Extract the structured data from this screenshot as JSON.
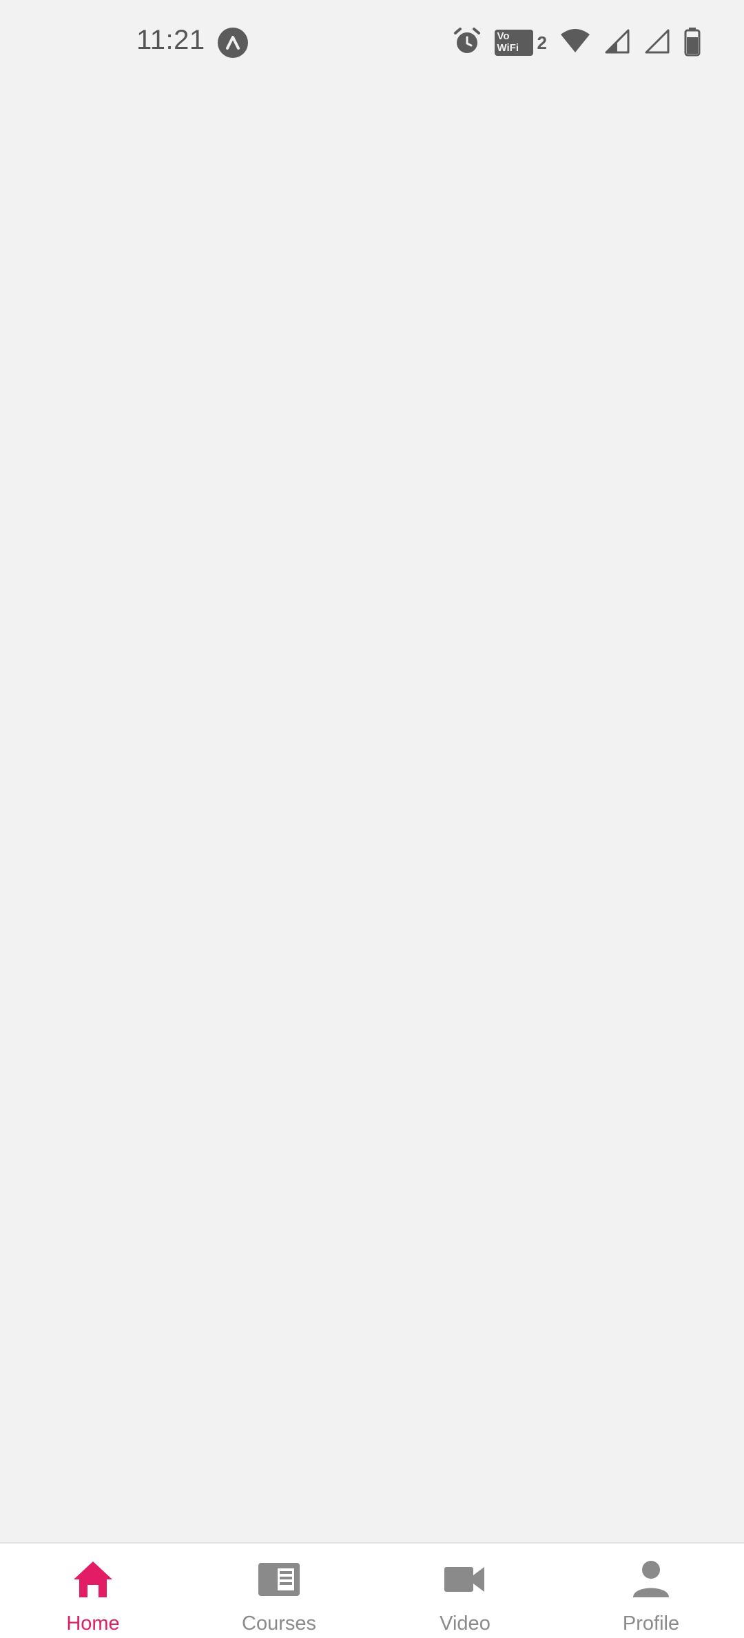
{
  "status_bar": {
    "time": "11:21",
    "vowifi_line1": "Vo",
    "vowifi_line2": "WiFi",
    "vowifi_sim": "2"
  },
  "bottom_nav": {
    "items": [
      {
        "label": "Home",
        "icon": "home-icon",
        "active": true
      },
      {
        "label": "Courses",
        "icon": "courses-icon",
        "active": false
      },
      {
        "label": "Video",
        "icon": "video-camera-icon",
        "active": false
      },
      {
        "label": "Profile",
        "icon": "person-icon",
        "active": false
      }
    ]
  },
  "colors": {
    "active": "#e31c66",
    "inactive": "#8a8a8a",
    "background": "#f2f2f2",
    "nav_background": "#ffffff"
  }
}
